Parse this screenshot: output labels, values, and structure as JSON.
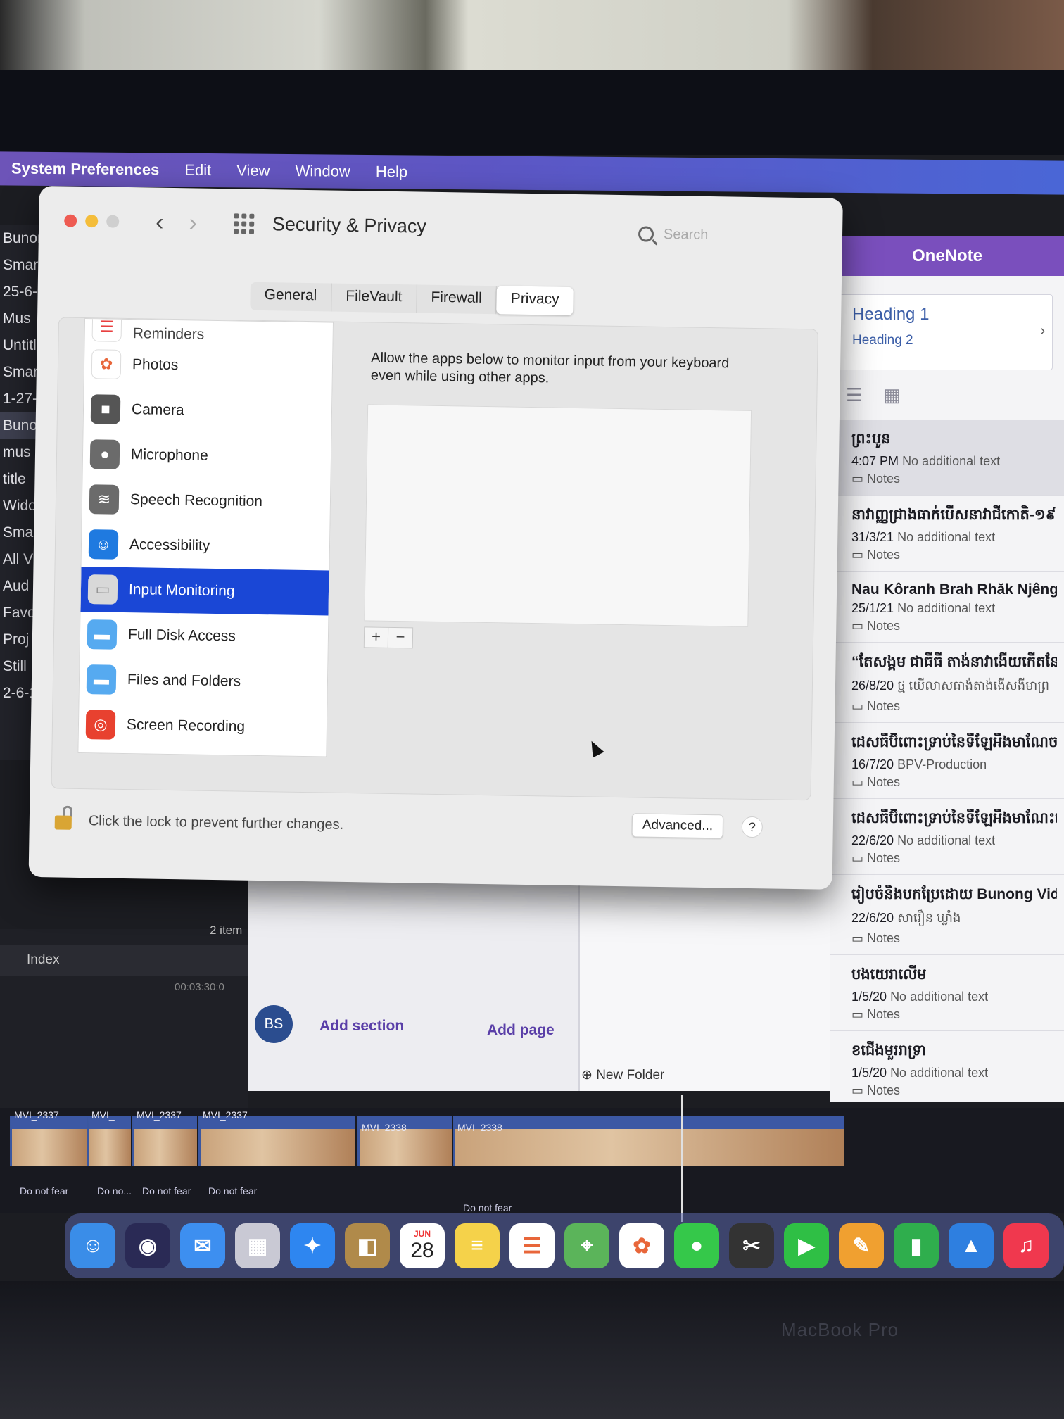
{
  "menubar": {
    "app": "System Preferences",
    "items": [
      "Edit",
      "View",
      "Window",
      "Help"
    ]
  },
  "left_col": [
    "Bunong",
    "Smar",
    "25-6-",
    "Mus",
    "Untitle",
    "Smar",
    "1-27-",
    "Buno",
    "mus",
    "title",
    "Widow",
    "Smar",
    "All V",
    "Aud",
    "Favo",
    "Proj",
    "Still",
    "2-6-1"
  ],
  "window": {
    "title": "Security & Privacy",
    "search_placeholder": "Search",
    "tabs": [
      "General",
      "FileVault",
      "Firewall",
      "Privacy"
    ],
    "active_tab": "Privacy",
    "privacy_list": [
      {
        "label": "Reminders",
        "icon": "reminders-icon",
        "color": "#ffffff"
      },
      {
        "label": "Photos",
        "icon": "photos-icon",
        "color": "#ffffff"
      },
      {
        "label": "Camera",
        "icon": "camera-icon",
        "color": "#555555"
      },
      {
        "label": "Microphone",
        "icon": "microphone-icon",
        "color": "#6b6b6b"
      },
      {
        "label": "Speech Recognition",
        "icon": "speech-recognition-icon",
        "color": "#6b6b6b"
      },
      {
        "label": "Accessibility",
        "icon": "accessibility-icon",
        "color": "#1f7ae0"
      },
      {
        "label": "Input Monitoring",
        "icon": "keyboard-icon",
        "color": "#d8d8d8"
      },
      {
        "label": "Full Disk Access",
        "icon": "folder-icon",
        "color": "#56aaf0"
      },
      {
        "label": "Files and Folders",
        "icon": "folder-icon",
        "color": "#56aaf0"
      },
      {
        "label": "Screen Recording",
        "icon": "screen-recording-icon",
        "color": "#e8412f"
      }
    ],
    "selected_item": "Input Monitoring",
    "description": "Allow the apps below to monitor input from your keyboard even while using other apps.",
    "plus": "+",
    "minus": "−",
    "lock_text": "Click the lock to prevent further changes.",
    "advanced_label": "Advanced...",
    "help_label": "?"
  },
  "onenote": {
    "title": "OneNote",
    "heading1": "Heading 1",
    "heading2": "Heading 2",
    "notes": [
      {
        "title": "ព្រះបូន",
        "time": "4:07 PM",
        "preview": "No additional text",
        "folder": "Notes"
      },
      {
        "title": "នាវាញ្ញជ្រាងធាក់បើសនាវាជីកោតិ-១៩",
        "time": "31/3/21",
        "preview": "No additional text",
        "folder": "Notes"
      },
      {
        "title": "Nau Kôranh Brah Rhăk Njêng",
        "time": "25/1/21",
        "preview": "No additional text",
        "folder": "Notes"
      },
      {
        "title": "“តែសង្គម ជាធីធី តាង់នាវាងើយកើតនែ ខាង់",
        "time": "26/8/20",
        "preview": "ថ្ម យើលាសធាង់តាង់ងើសងីមាព្រ",
        "folder": "Notes"
      },
      {
        "title": "ដេសធីប៊ីពោះទ្រាប់នៃទីឡែអីងមាណែច",
        "time": "16/7/20",
        "preview": "BPV-Production",
        "folder": "Notes"
      },
      {
        "title": "ដេសធីប៊ីពោះទ្រាប់នៃទីឡែអីងមាណែះបើសកើង",
        "time": "22/6/20",
        "preview": "No additional text",
        "folder": "Notes"
      },
      {
        "title": "រៀបចំនិងបកប្រែដោយ Bunong Video Pr...",
        "time": "22/6/20",
        "preview": "សារឿន ឃ្លាំង",
        "folder": "Notes"
      },
      {
        "title": "បងយេរាលើម",
        "time": "1/5/20",
        "preview": "No additional text",
        "folder": "Notes"
      },
      {
        "title": "ខជើងមួររាទ្រា",
        "time": "1/5/20",
        "preview": "No additional text",
        "folder": "Notes"
      }
    ],
    "avatar": "BS",
    "add_section": "Add section",
    "add_page": "Add page",
    "new_folder": "New Folder"
  },
  "fcp": {
    "items_count": "2 item",
    "index_label": "Index",
    "timecode": "00:03:30:0",
    "clips": [
      {
        "label": "MVI_2337",
        "caption": "Do not fear"
      },
      {
        "label": "MVI_",
        "caption": "Do no..."
      },
      {
        "label": "MVI_2337",
        "caption": "Do not fear"
      },
      {
        "label": "MVI_2337",
        "caption": "Do not fear"
      },
      {
        "label": "MVI_2338",
        "caption": ""
      },
      {
        "label": "MVI_2338",
        "caption": "Do not fear"
      }
    ]
  },
  "dock": {
    "calendar_month": "JUN",
    "calendar_day": "28",
    "apps": [
      {
        "name": "finder-icon",
        "color": "#3a8de8"
      },
      {
        "name": "siri-icon",
        "color": "#2a2a55"
      },
      {
        "name": "mail-icon",
        "color": "#3d8ff0"
      },
      {
        "name": "launchpad-icon",
        "color": "#c9c9d4"
      },
      {
        "name": "safari-icon",
        "color": "#2e86f0"
      },
      {
        "name": "contacts-icon",
        "color": "#b08a4a"
      },
      {
        "name": "calendar-icon",
        "color": "#ffffff"
      },
      {
        "name": "notes-icon",
        "color": "#f5d24a"
      },
      {
        "name": "reminders-icon",
        "color": "#ffffff"
      },
      {
        "name": "maps-icon",
        "color": "#5bb45a"
      },
      {
        "name": "photos-icon",
        "color": "#ffffff"
      },
      {
        "name": "messages-icon",
        "color": "#35c84a"
      },
      {
        "name": "final-cut-icon",
        "color": "#333333"
      },
      {
        "name": "facetime-icon",
        "color": "#2fbf45"
      },
      {
        "name": "pages-icon",
        "color": "#f0a030"
      },
      {
        "name": "numbers-icon",
        "color": "#2fae4d"
      },
      {
        "name": "keynote-icon",
        "color": "#2e7fe0"
      },
      {
        "name": "music-icon",
        "color": "#f0384e"
      }
    ]
  },
  "device_label": "MacBook Pro"
}
